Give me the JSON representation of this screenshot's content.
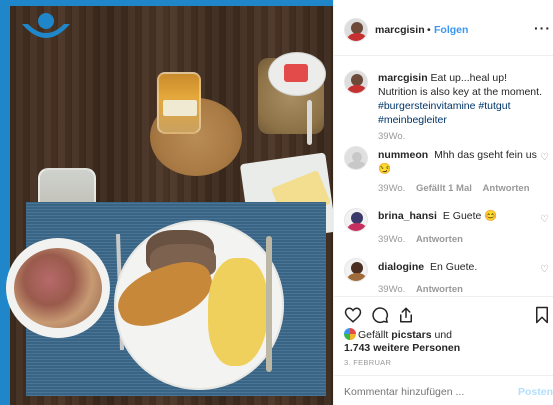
{
  "photo": {
    "alt_subject": "",
    "icons": [
      "logo-icon"
    ]
  },
  "header": {
    "username": "marcgisin",
    "separator": "•",
    "follow_label": "Folgen",
    "more_label": "···"
  },
  "caption": {
    "username": "marcgisin",
    "text": "Eat up...heal up! Nutrition is also key at the moment.",
    "hashtags": [
      "#burgersteinvitamine",
      "#tutgut",
      "#meinbegleiter"
    ],
    "age": "39Wo."
  },
  "comments": [
    {
      "username": "nummeon",
      "text": "Mhh das gseht fein us 😏",
      "age": "39Wo.",
      "likes_label": "Gefällt 1 Mal",
      "reply_label": "Antworten"
    },
    {
      "username": "brina_hansi",
      "text": "E Guete 😊",
      "age": "39Wo.",
      "reply_label": "Antworten"
    },
    {
      "username": "dialogine",
      "text": "En Guete.",
      "age": "39Wo.",
      "reply_label": "Antworten"
    }
  ],
  "likes": {
    "prefix": "Gefällt",
    "user": "picstars",
    "middle": "und",
    "count_text": "1.743 weitere Personen"
  },
  "date": "3. FEBRUAR",
  "comment_box": {
    "placeholder": "Kommentar hinzufügen ...",
    "post_label": "Posten"
  },
  "colors": {
    "link_blue": "#3897f0",
    "hashtag": "#003569",
    "post_disabled": "#b2dffc",
    "brand_blue": "#1f86c9"
  }
}
